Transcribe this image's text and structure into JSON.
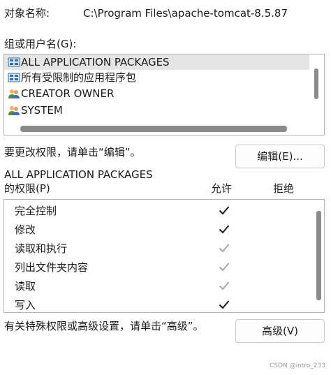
{
  "object": {
    "label": "对象名称:",
    "value": "C:\\Program Files\\apache-tomcat-8.5.87"
  },
  "groups": {
    "label": "组或用户名(G):",
    "items": [
      {
        "name": "ALL APPLICATION PACKAGES",
        "icon": "app-packages-icon",
        "selected": true
      },
      {
        "name": "所有受限制的应用程序包",
        "icon": "app-packages-icon",
        "selected": false
      },
      {
        "name": "CREATOR OWNER",
        "icon": "users-icon",
        "selected": false
      },
      {
        "name": "SYSTEM",
        "icon": "users-icon",
        "selected": false
      }
    ]
  },
  "edit": {
    "hint": "要更改权限，请单击“编辑”。",
    "button": "编辑(E)..."
  },
  "permissions": {
    "for": "ALL APPLICATION PACKAGES",
    "label": "的权限(P)",
    "allow_header": "允许",
    "deny_header": "拒绝",
    "rows": [
      {
        "name": "完全控制",
        "allow": "checked",
        "allow_color": "#1b1b1b"
      },
      {
        "name": "修改",
        "allow": "checked",
        "allow_color": "#1b1b1b"
      },
      {
        "name": "读取和执行",
        "allow": "inherited",
        "allow_color": "#a8a8a8"
      },
      {
        "name": "列出文件夹内容",
        "allow": "inherited",
        "allow_color": "#a8a8a8"
      },
      {
        "name": "读取",
        "allow": "inherited",
        "allow_color": "#a8a8a8"
      },
      {
        "name": "写入",
        "allow": "checked",
        "allow_color": "#1b1b1b"
      }
    ]
  },
  "advanced": {
    "hint": "有关特殊权限或高级设置，请单击“高级”。",
    "button": "高级(V)"
  },
  "watermark": "CSDN @intro_233"
}
